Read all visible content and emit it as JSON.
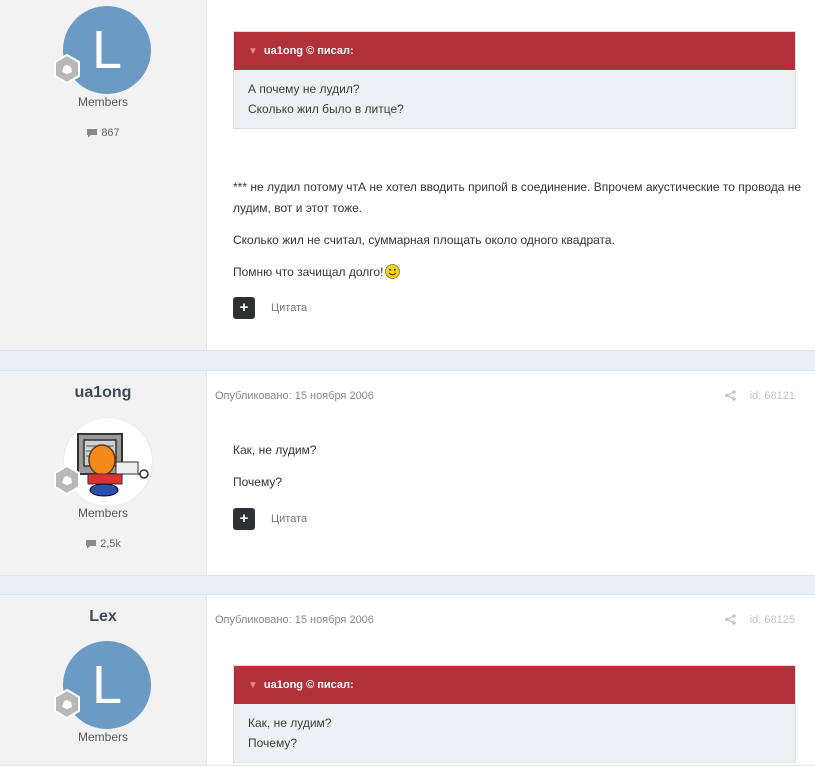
{
  "posts": [
    {
      "author": {
        "name": "",
        "avatar_letter": "L",
        "group": "Members",
        "post_count": "867"
      },
      "quote": {
        "header": "ua1ong © писал:",
        "lines": [
          "А почему не лудил?",
          "Сколько жил было в литце?"
        ]
      },
      "paragraphs": [
        "*** не лудил потому чтА не хотел вводить припой в соединение. Впрочем акустические то провода не лудим, вот и этот тоже.",
        "Сколько жил не считал, суммарная площать около одного квадрата.",
        "Помню что зачищал долго!"
      ],
      "actions": {
        "plus_icon": "+",
        "quote_label": "Цитата"
      }
    },
    {
      "author": {
        "name": "ua1ong",
        "group": "Members",
        "post_count": "2,5k"
      },
      "meta": {
        "published": "Опубликовано: 15 ноября 2006",
        "post_id": "id: 68121"
      },
      "paragraphs": [
        "Как, не лудим?",
        "Почему?"
      ],
      "actions": {
        "plus_icon": "+",
        "quote_label": "Цитата"
      }
    },
    {
      "author": {
        "name": "Lex",
        "avatar_letter": "L",
        "group": "Members"
      },
      "meta": {
        "published": "Опубликовано: 15 ноября 2006",
        "post_id": "id: 68125"
      },
      "quote": {
        "header": "ua1ong © писал:",
        "lines": [
          "Как, не лудим?",
          "Почему?"
        ]
      }
    }
  ],
  "icons": {
    "quote_chevron": "chevron-down-icon",
    "share": "share-icon",
    "comment": "comment-icon",
    "rank": "rank-badge-icon",
    "smiley": "smiley-icon"
  },
  "colors": {
    "quote_header": "#b0313a",
    "avatar_bg": "#6b9ac4",
    "author_col_bg": "#f2f2f2"
  }
}
